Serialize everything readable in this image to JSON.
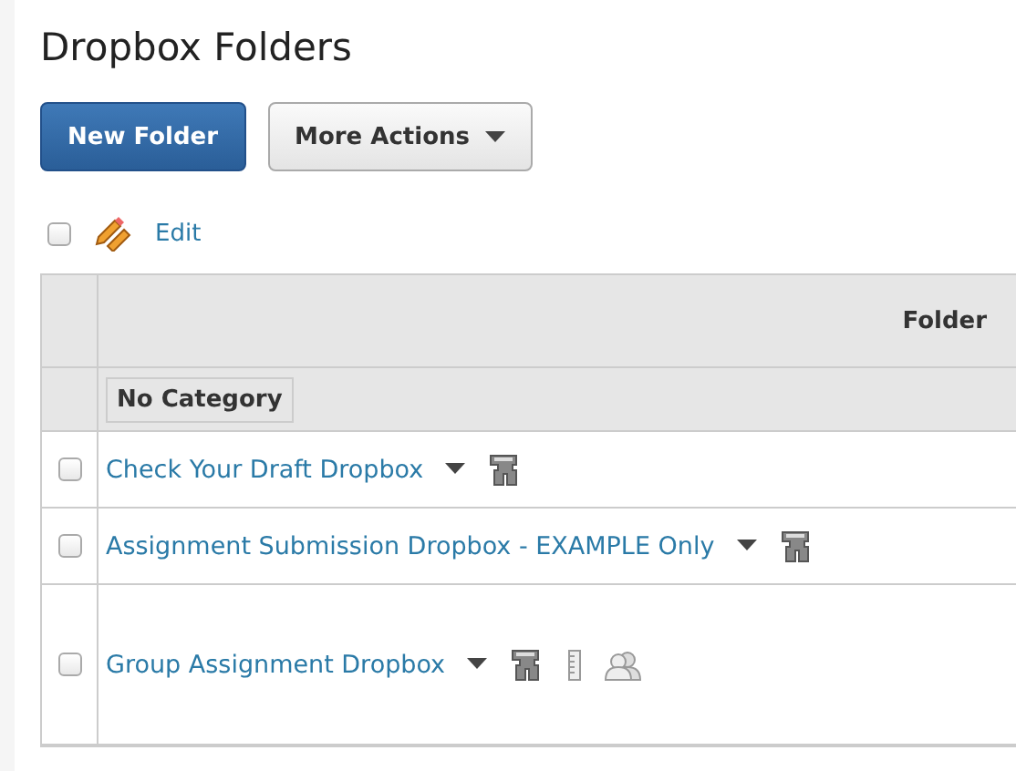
{
  "title": "Dropbox Folders",
  "buttons": [
    {
      "label": "New Folder",
      "kind": "primary"
    },
    {
      "label": "More Actions",
      "kind": "menu"
    }
  ],
  "edit_bar": {
    "checked": false,
    "label": "Edit"
  },
  "table": {
    "columns": [
      "Folder"
    ],
    "category": "No Category",
    "rows": [
      {
        "checked": false,
        "name": "Check Your Draft Dropbox",
        "icons": [
          {
            "kind": "binoculars"
          }
        ]
      },
      {
        "checked": false,
        "name": "Assignment Submission Dropbox - EXAMPLE Only",
        "icons": [
          {
            "kind": "binoculars"
          }
        ]
      },
      {
        "checked": false,
        "name": "Group Assignment Dropbox",
        "icons": [
          {
            "kind": "binoculars"
          },
          {
            "kind": "ruler"
          },
          {
            "kind": "people"
          }
        ]
      }
    ]
  }
}
